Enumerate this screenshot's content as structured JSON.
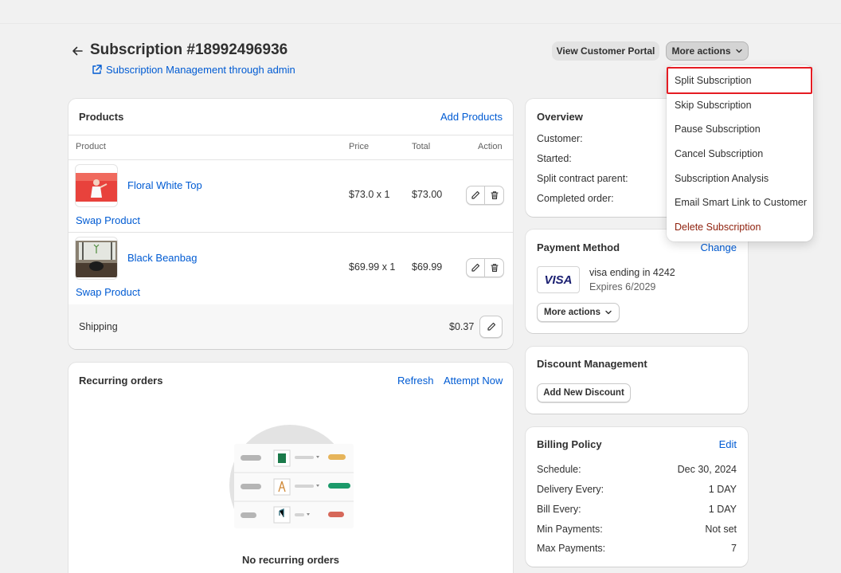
{
  "header": {
    "title": "Subscription #18992496936",
    "sublink": "Subscription Management through admin",
    "view_portal": "View Customer Portal",
    "more_actions": "More actions"
  },
  "dropdown": {
    "items": [
      {
        "label": "Split Subscription"
      },
      {
        "label": "Skip Subscription"
      },
      {
        "label": "Pause Subscription"
      },
      {
        "label": "Cancel Subscription"
      },
      {
        "label": "Subscription Analysis"
      },
      {
        "label": "Email Smart Link to Customer"
      },
      {
        "label": "Delete Subscription"
      }
    ]
  },
  "products": {
    "title": "Products",
    "add_link": "Add Products",
    "columns": {
      "product": "Product",
      "price": "Price",
      "total": "Total",
      "action": "Action"
    },
    "rows": [
      {
        "name": "Floral White Top",
        "price": "$73.0 x 1",
        "total": "$73.00",
        "swap": "Swap Product"
      },
      {
        "name": "Black Beanbag",
        "price": "$69.99 x 1",
        "total": "$69.99",
        "swap": "Swap Product"
      }
    ],
    "shipping_label": "Shipping",
    "shipping_value": "$0.37"
  },
  "recurring": {
    "title": "Recurring orders",
    "refresh": "Refresh",
    "attempt": "Attempt Now",
    "empty": "No recurring orders"
  },
  "overview": {
    "title": "Overview",
    "rows": [
      {
        "label": "Customer:"
      },
      {
        "label": "Started:"
      },
      {
        "label": "Split contract parent:"
      },
      {
        "label": "Completed order:"
      }
    ]
  },
  "payment": {
    "title": "Payment Method",
    "change": "Change",
    "card_brand": "VISA",
    "card_line": "visa ending in 4242",
    "expires": "Expires 6/2029",
    "more_actions": "More actions"
  },
  "discount": {
    "title": "Discount Management",
    "add_button": "Add New Discount"
  },
  "billing": {
    "title": "Billing Policy",
    "edit": "Edit",
    "rows": [
      {
        "label": "Schedule:",
        "value": "Dec 30, 2024"
      },
      {
        "label": "Delivery Every:",
        "value": "1 DAY"
      },
      {
        "label": "Bill Every:",
        "value": "1 DAY"
      },
      {
        "label": "Min Payments:",
        "value": "Not set"
      },
      {
        "label": "Max Payments:",
        "value": "7"
      }
    ]
  },
  "colors": {
    "link": "#005bd3",
    "danger": "#8e1f0b",
    "highlight": "#e51c23"
  }
}
